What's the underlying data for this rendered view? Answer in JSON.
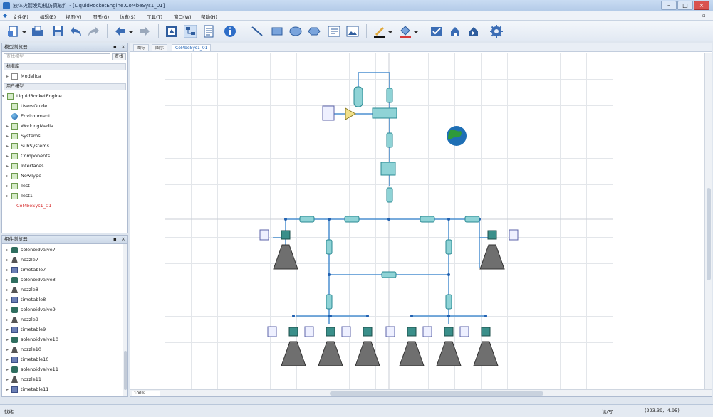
{
  "window": {
    "title": "液体火箭发动机仿真软件 - [LiquidRocketEngine.CoMbeSys1_01]"
  },
  "menu": [
    "文件(F)",
    "编辑(E)",
    "视图(V)",
    "图形(G)",
    "仿真(S)",
    "工具(T)",
    "窗口(W)",
    "帮助(H)"
  ],
  "model_browser": {
    "title": "模型浏览器",
    "search_placeholder": "查找模型",
    "search_button": "查找",
    "section_std": "标准库",
    "section_user": "用户模型",
    "std_items": [
      {
        "label": "Modelica",
        "icon": "doc-icon"
      }
    ],
    "user_root": "LiquidRocketEngine",
    "user_items": [
      {
        "label": "UsersGuide",
        "icon": "package-icon"
      },
      {
        "label": "Environment",
        "icon": "globe-icon"
      },
      {
        "label": "WorkingMedia",
        "icon": "package-icon"
      },
      {
        "label": "Systems",
        "icon": "package-icon"
      },
      {
        "label": "SubSystems",
        "icon": "package-icon"
      },
      {
        "label": "Components",
        "icon": "package-icon"
      },
      {
        "label": "Interfaces",
        "icon": "package-icon"
      },
      {
        "label": "NewType",
        "icon": "package-icon"
      },
      {
        "label": "Test",
        "icon": "package-icon"
      },
      {
        "label": "Test1",
        "icon": "package-icon"
      }
    ],
    "selected_model": "CoMbeSys1_01"
  },
  "component_browser": {
    "title": "组件浏览器",
    "items": [
      {
        "label": "solenoidvalve7",
        "icon": "valve-icon"
      },
      {
        "label": "nozzle7",
        "icon": "nozzle-icon"
      },
      {
        "label": "timetable7",
        "icon": "timetable-icon"
      },
      {
        "label": "solenoidvalve8",
        "icon": "valve-icon"
      },
      {
        "label": "nozzle8",
        "icon": "nozzle-icon"
      },
      {
        "label": "timetable8",
        "icon": "timetable-icon"
      },
      {
        "label": "solenoidvalve9",
        "icon": "valve-icon"
      },
      {
        "label": "nozzle9",
        "icon": "nozzle-icon"
      },
      {
        "label": "timetable9",
        "icon": "timetable-icon"
      },
      {
        "label": "solenoidvalve10",
        "icon": "valve-icon"
      },
      {
        "label": "nozzle10",
        "icon": "nozzle-icon"
      },
      {
        "label": "timetable10",
        "icon": "timetable-icon"
      },
      {
        "label": "solenoidvalve11",
        "icon": "valve-icon"
      },
      {
        "label": "nozzle11",
        "icon": "nozzle-icon"
      },
      {
        "label": "timetable11",
        "icon": "timetable-icon"
      }
    ]
  },
  "canvas": {
    "tabs": [
      {
        "label": "图标"
      },
      {
        "label": "图示"
      },
      {
        "label": "CoMbeSys1_01"
      }
    ],
    "zoom": "100%"
  },
  "status": {
    "left": "就绪",
    "mode": "读/写",
    "coords": "(293.39, -4.95)"
  }
}
